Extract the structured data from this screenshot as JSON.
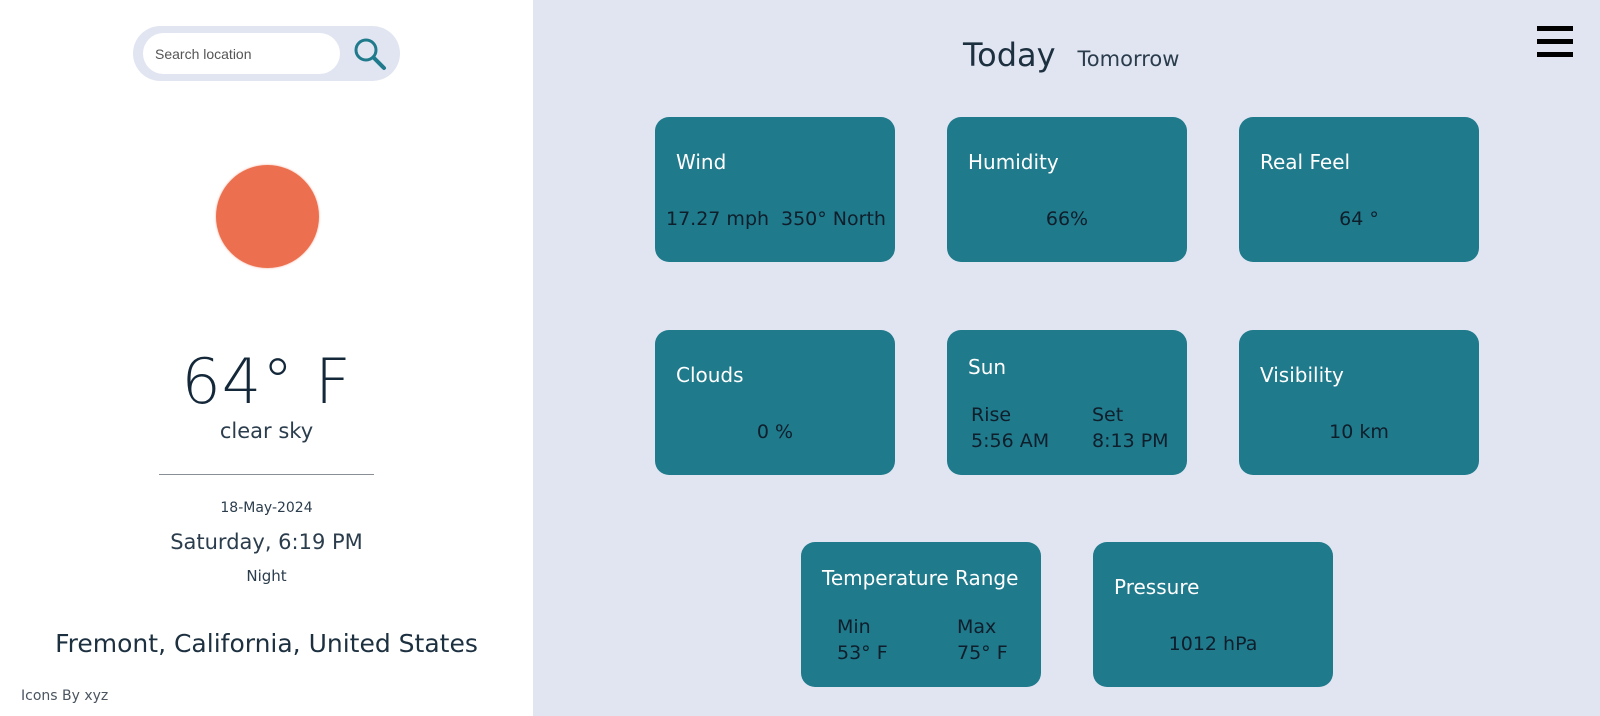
{
  "search": {
    "placeholder": "Search location"
  },
  "current": {
    "temperature": "64° F",
    "condition": "clear sky",
    "date": "18-May-2024",
    "day_time": "Saturday, 6:19 PM",
    "period": "Night",
    "location": "Fremont, California, United States",
    "weather_icon": "sun-icon",
    "sun_color": "#ec704f"
  },
  "credit": "Icons By xyz",
  "tabs": {
    "today": "Today",
    "tomorrow": "Tomorrow"
  },
  "menu_icon": "hamburger-menu-icon",
  "colors": {
    "card": "#1f7a8c",
    "panel": "#e1e5f1"
  },
  "cards": {
    "wind": {
      "title": "Wind",
      "speed": "17.27 mph",
      "direction": "350° North"
    },
    "humidity": {
      "title": "Humidity",
      "value": "66%"
    },
    "real_feel": {
      "title": "Real Feel",
      "value": "64 °"
    },
    "clouds": {
      "title": "Clouds",
      "value": "0 %"
    },
    "sun": {
      "title": "Sun",
      "rise_label": "Rise",
      "rise_value": "5:56 AM",
      "set_label": "Set",
      "set_value": "8:13 PM"
    },
    "visibility": {
      "title": "Visibility",
      "value": "10 km"
    },
    "temp_range": {
      "title": "Temperature Range",
      "min_label": "Min",
      "min_value": "53° F",
      "max_label": "Max",
      "max_value": "75° F"
    },
    "pressure": {
      "title": "Pressure",
      "value": "1012 hPa"
    }
  }
}
